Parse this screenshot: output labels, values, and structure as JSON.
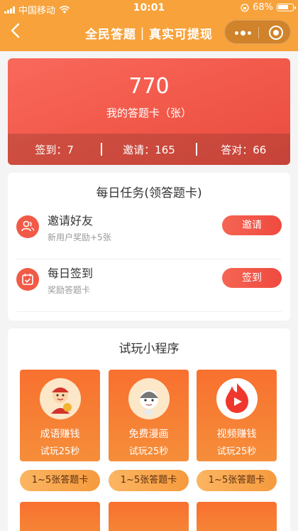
{
  "status_bar": {
    "carrier": "中国移动",
    "time": "10:01",
    "battery": "68%"
  },
  "nav": {
    "title": "全民答题｜真实可提现"
  },
  "hero": {
    "count": "770",
    "count_label": "我的答题卡（张）",
    "stats": [
      {
        "label": "签到：7"
      },
      {
        "label": "邀请：165"
      },
      {
        "label": "答对：66"
      }
    ]
  },
  "daily_tasks": {
    "title": "每日任务(领答题卡)",
    "items": [
      {
        "name": "邀请好友",
        "sub": "新用户奖励+5张",
        "button": "邀请",
        "icon": "users-icon"
      },
      {
        "name": "每日签到",
        "sub": "奖励答题卡",
        "button": "签到",
        "icon": "calendar-check-icon"
      }
    ]
  },
  "mini_programs": {
    "title": "试玩小程序",
    "items": [
      {
        "name": "成语赚钱",
        "time": "试玩25秒",
        "reward": "1~5张答题卡",
        "icon": "idiom-mascot-icon"
      },
      {
        "name": "免费漫画",
        "time": "试玩25秒",
        "reward": "1~5张答题卡",
        "icon": "comic-character-icon"
      },
      {
        "name": "视频赚钱",
        "time": "试玩25秒",
        "reward": "1~5张答题卡",
        "icon": "flame-play-icon"
      }
    ]
  },
  "colors": {
    "nav_bg": "#f7a23a",
    "hero_red": "#f15849",
    "button_red": "#ef4a3f",
    "mini_orange": "#f8702f",
    "pill_orange": "#f69a3d"
  }
}
